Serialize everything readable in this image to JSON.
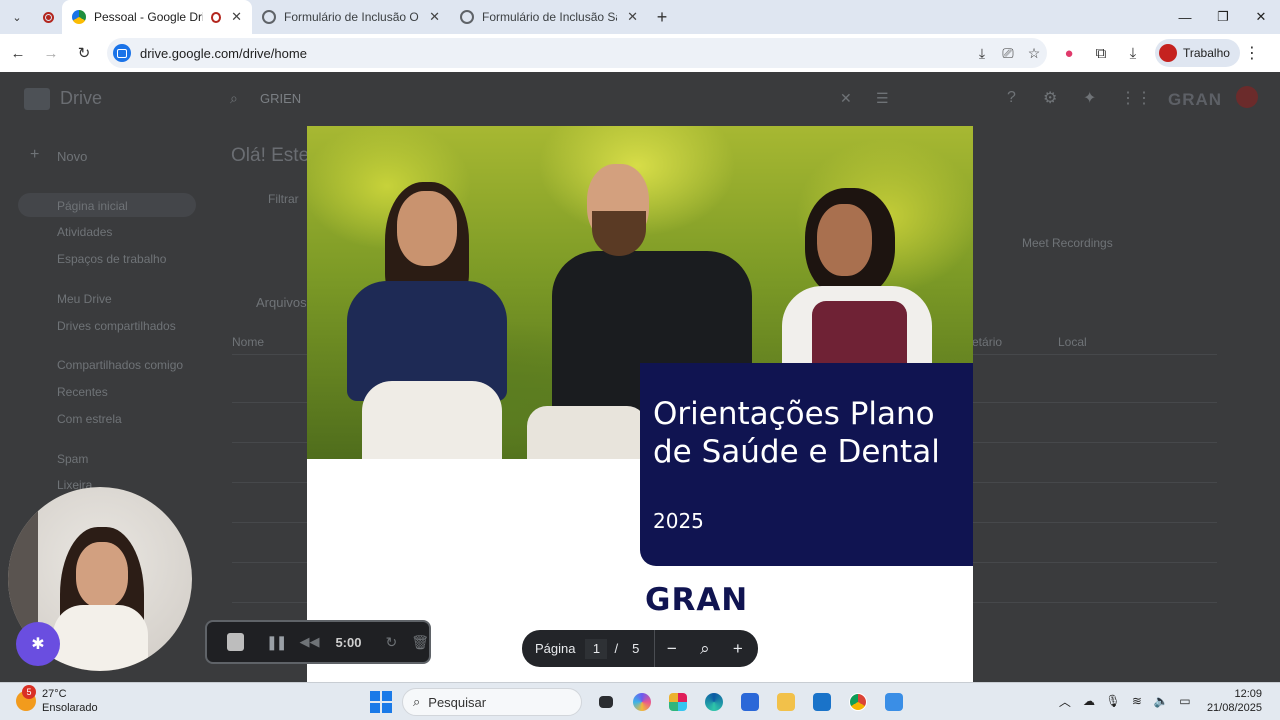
{
  "browser": {
    "tabs": [
      {
        "title": "Pessoal - Google Drive",
        "active": true
      },
      {
        "title": "Formulário de Inclusão Odonto",
        "active": false
      },
      {
        "title": "Formulário de Inclusão Saúde",
        "active": false
      }
    ],
    "url": "drive.google.com/drive/home",
    "profile_label": "Trabalho"
  },
  "drive_background": {
    "app_name": "Drive",
    "search_query": "GRIEN",
    "new_button": "Novo",
    "greeting": "Olá! Este",
    "nav_items": [
      "Página inicial",
      "Atividades",
      "Espaços de trabalho",
      "Meu Drive",
      "Drives compartilhados",
      "Compartilhados comigo",
      "Recentes",
      "Com estrela",
      "Spam",
      "Lixeira"
    ],
    "filter_text": "Filtrar",
    "section_label": "Arquivos",
    "col_name": "Nome",
    "col_owner": "Proprietário",
    "col_location": "Local",
    "suggested_folder": "Meet Recordings",
    "brand": "GRAN"
  },
  "pdf": {
    "title": "Orientações Plano de Saúde e Dental",
    "year": "2025",
    "logo": "GRAN"
  },
  "pager": {
    "label": "Página",
    "current": "1",
    "separator": "/",
    "total": "5"
  },
  "recorder": {
    "time": "5:00"
  },
  "taskbar": {
    "temperature": "27°C",
    "condition": "Ensolarado",
    "weather_badge": "5",
    "search_placeholder": "Pesquisar",
    "time": "12:09",
    "date": "21/08/2025"
  },
  "colors": {
    "pdf_title_bg": "#101451",
    "brand_red": "#c5221f",
    "overlay_bg": "#3a3b3d"
  }
}
